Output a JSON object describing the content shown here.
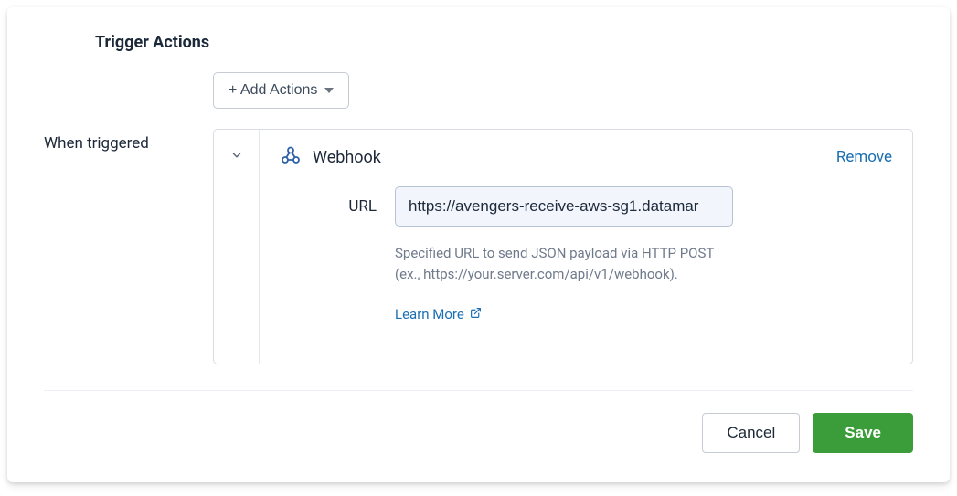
{
  "section": {
    "title": "Trigger Actions",
    "add_actions_label": "+ Add Actions",
    "when_triggered_label": "When triggered"
  },
  "action": {
    "type_label": "Webhook",
    "remove_label": "Remove",
    "url_label": "URL",
    "url_value": "https://avengers-receive-aws-sg1.datamar",
    "help_text": "Specified URL to send JSON payload via HTTP POST (ex., https://your.server.com/api/v1/webhook).",
    "learn_more_label": "Learn More"
  },
  "footer": {
    "cancel_label": "Cancel",
    "save_label": "Save"
  },
  "colors": {
    "link": "#1a6fb3",
    "primary": "#3a9d3a"
  }
}
